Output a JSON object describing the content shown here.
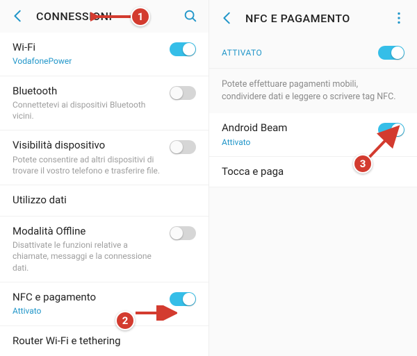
{
  "colors": {
    "accent": "#2196c9",
    "toggle_on": "#35bee8",
    "badge": "#d33b2f"
  },
  "left": {
    "title": "CONNESSIONI",
    "items": [
      {
        "title": "Wi-Fi",
        "sub": "VodafonePower",
        "subStyle": "link",
        "toggle": "on"
      },
      {
        "title": "Bluetooth",
        "sub": "Connettetevi ai dispositivi Bluetooth vicini.",
        "toggle": "off"
      },
      {
        "title": "Visibilità dispositivo",
        "sub": "Potete consentire ad altri dispositivi di trovare il vostro telefono e trasferire file.",
        "toggle": "off"
      },
      {
        "title": "Utilizzo dati"
      },
      {
        "title": "Modalità Offline",
        "sub": "Disattivate le funzioni relative a chiamate, messaggi e la connessione dati.",
        "toggle": "off"
      },
      {
        "title": "NFC e pagamento",
        "sub": "Attivato",
        "subStyle": "link",
        "toggle": "on"
      },
      {
        "title": "Router Wi-Fi e tethering"
      }
    ]
  },
  "right": {
    "title": "NFC E PAGAMENTO",
    "section": "ATTIVATO",
    "sectionToggle": "on",
    "desc": "Potete effettuare pagamenti mobili, condividere dati e leggere o scrivere tag NFC.",
    "items": [
      {
        "title": "Android Beam",
        "sub": "Attivato",
        "subStyle": "link",
        "toggle": "on"
      },
      {
        "title": "Tocca e paga"
      }
    ]
  },
  "badges": {
    "b1": "1",
    "b2": "2",
    "b3": "3"
  }
}
